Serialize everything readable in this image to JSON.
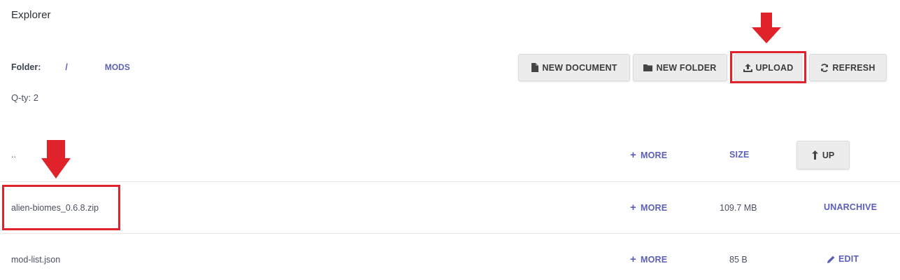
{
  "page": {
    "title": "Explorer"
  },
  "folder": {
    "label": "Folder:",
    "root": "/",
    "current": "MODS"
  },
  "qty": "Q-ty: 2",
  "toolbar": {
    "new_document": "NEW DOCUMENT",
    "new_folder": "NEW FOLDER",
    "upload": "UPLOAD",
    "refresh": "REFRESH"
  },
  "header_row": {
    "name": "..",
    "more": "MORE",
    "size": "SIZE",
    "up": "UP"
  },
  "files": [
    {
      "name": "alien-biomes_0.6.8.zip",
      "more": "MORE",
      "size": "109.7 MB",
      "action": "UNARCHIVE"
    },
    {
      "name": "mod-list.json",
      "more": "MORE",
      "size": "85 B",
      "action": "EDIT"
    }
  ],
  "colors": {
    "accent": "#5b5fb8",
    "highlight": "#e0232b",
    "button_bg": "#ececec"
  },
  "icons": [
    "document-icon",
    "folder-icon",
    "upload-icon",
    "refresh-icon",
    "plus-icon",
    "up-arrow-icon",
    "pencil-icon",
    "down-arrow-annotation"
  ]
}
